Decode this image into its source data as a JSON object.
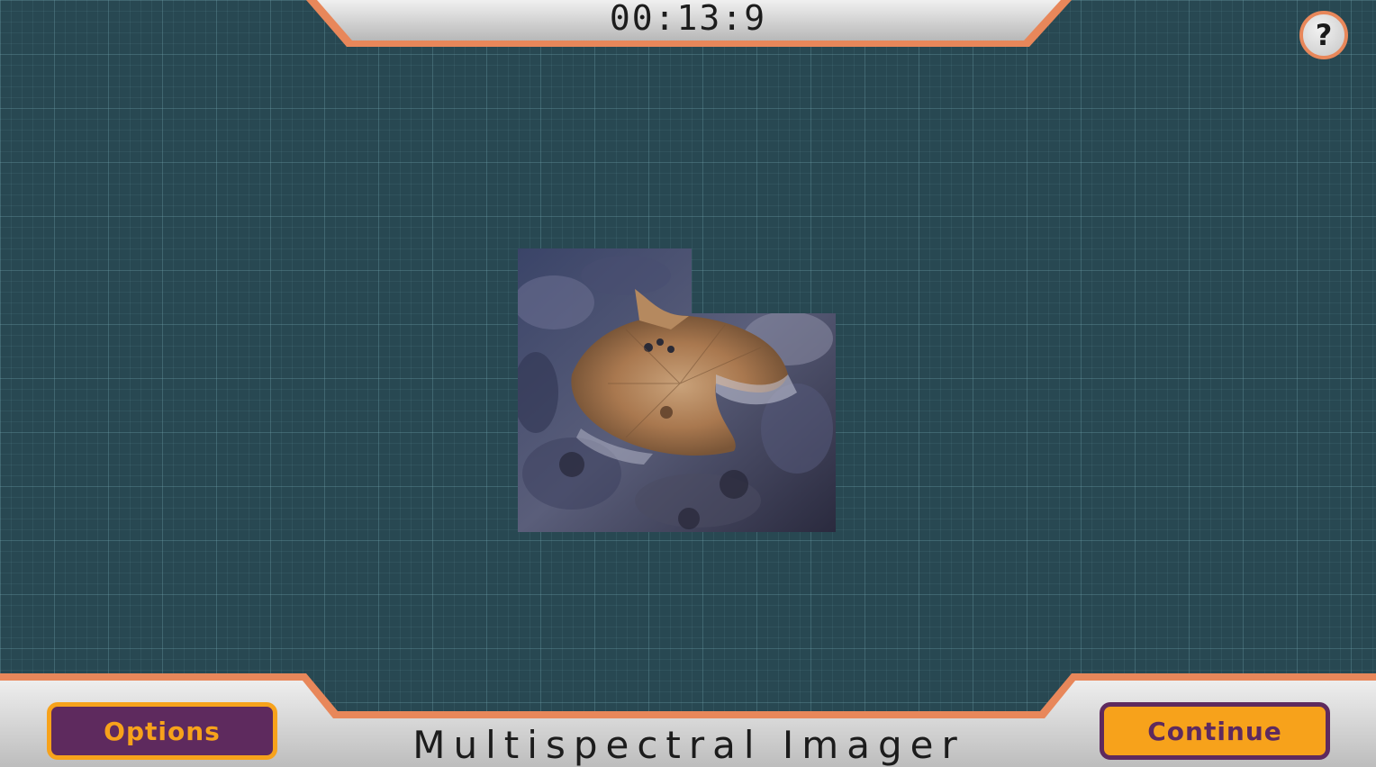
{
  "hud": {
    "timer": "00:13:9",
    "help_label": "?"
  },
  "puzzle": {
    "description_icon": "crater-surface-image"
  },
  "footer": {
    "title": "Multispectral Imager",
    "options_label": "Options",
    "continue_label": "Continue"
  },
  "colors": {
    "background": "#284852",
    "accent_orange": "#e8875a",
    "button_gold": "#f7a21b",
    "button_purple": "#5e2a5e",
    "panel_gray": "#d0d0d0"
  }
}
